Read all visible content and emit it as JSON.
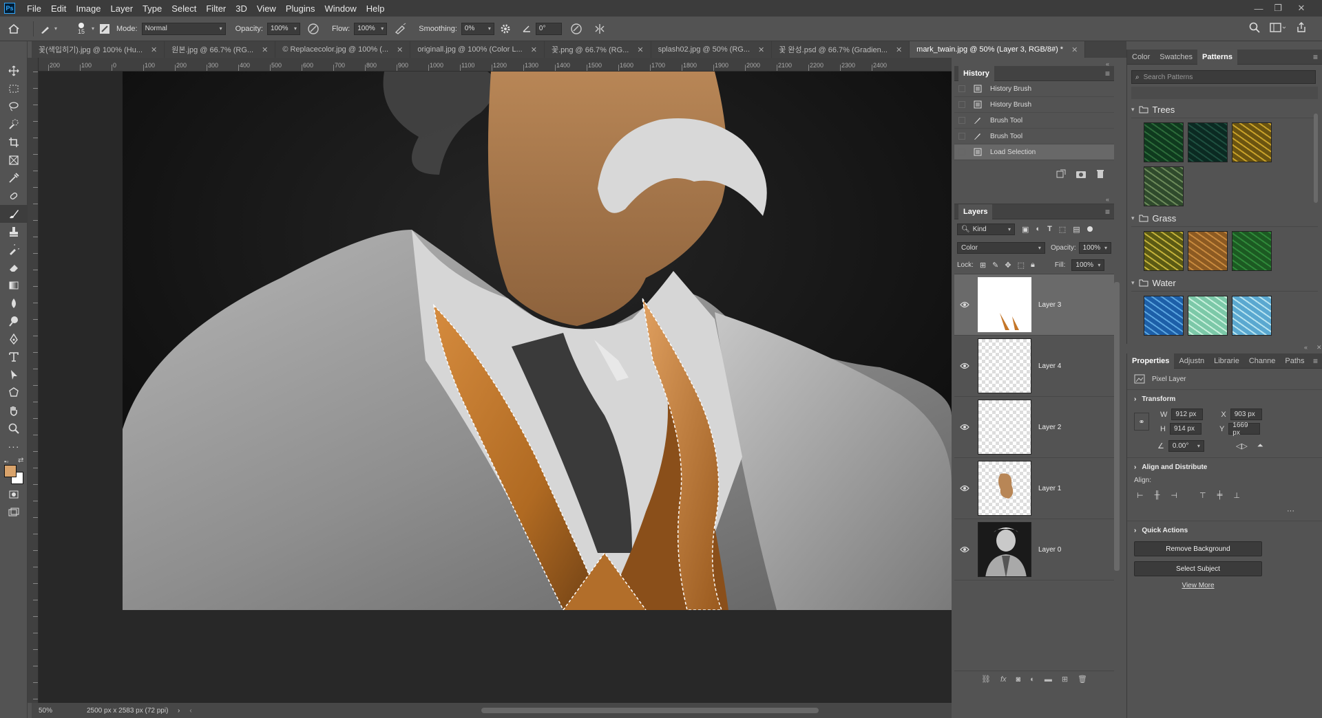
{
  "app": {
    "logo": "Ps",
    "menus": [
      "File",
      "Edit",
      "Image",
      "Layer",
      "Type",
      "Select",
      "Filter",
      "3D",
      "View",
      "Plugins",
      "Window",
      "Help"
    ]
  },
  "options": {
    "brush_size": "15",
    "mode_label": "Mode:",
    "mode_value": "Normal",
    "opacity_label": "Opacity:",
    "opacity_value": "100%",
    "flow_label": "Flow:",
    "flow_value": "100%",
    "smoothing_label": "Smoothing:",
    "smoothing_value": "0%",
    "angle_value": "0°"
  },
  "tabs": [
    {
      "label": "꽃(색입히기).jpg @ 100% (Hu..."
    },
    {
      "label": "원본.jpg @ 66.7% (RG..."
    },
    {
      "label": "© Replacecolor.jpg @ 100% (..."
    },
    {
      "label": "originall.jpg @ 100% (Color L..."
    },
    {
      "label": "꽃.png @ 66.7% (RG..."
    },
    {
      "label": "splash02.jpg @ 50% (RG..."
    },
    {
      "label": "꽃 완성.psd @ 66.7% (Gradien..."
    },
    {
      "label": "mark_twain.jpg @ 50% (Layer 3, RGB/8#) *"
    }
  ],
  "ruler": {
    "h_ticks": [
      "200",
      "100",
      "0",
      "100",
      "200",
      "300",
      "400",
      "500",
      "600",
      "700",
      "800",
      "900",
      "1000",
      "1100",
      "1200",
      "1300",
      "1400",
      "1500",
      "1600",
      "1700",
      "1800",
      "1900",
      "2000",
      "2100",
      "2200",
      "2300",
      "2400"
    ]
  },
  "status": {
    "zoom": "50%",
    "doc_info": "2500 px x 2583 px (72 ppi)"
  },
  "history": {
    "title": "History",
    "items": [
      {
        "label": "History Brush",
        "icon": "doc-icon"
      },
      {
        "label": "History Brush",
        "icon": "doc-icon"
      },
      {
        "label": "Brush Tool",
        "icon": "brush-icon"
      },
      {
        "label": "Brush Tool",
        "icon": "brush-icon"
      },
      {
        "label": "Load Selection",
        "icon": "doc-icon"
      }
    ]
  },
  "layers": {
    "title": "Layers",
    "filter_label": "Kind",
    "blend_mode": "Color",
    "opacity_label": "Opacity:",
    "opacity_value": "100%",
    "lock_label": "Lock:",
    "fill_label": "Fill:",
    "fill_value": "100%",
    "items": [
      {
        "name": "Layer 3"
      },
      {
        "name": "Layer 4"
      },
      {
        "name": "Layer 2"
      },
      {
        "name": "Layer 1"
      },
      {
        "name": "Layer 0"
      }
    ]
  },
  "patterns": {
    "tabs": [
      "Color",
      "Swatches",
      "Patterns"
    ],
    "search_placeholder": "Search Patterns",
    "groups": [
      {
        "name": "Trees",
        "swatches": [
          [
            "#0f3a1e",
            "#2c6b3a"
          ],
          [
            "#0b2a22",
            "#1f5040"
          ],
          [
            "#6b5410",
            "#c9a22a"
          ],
          [
            "#2f4a2c",
            "#6c8a5a"
          ]
        ]
      },
      {
        "name": "Grass",
        "swatches": [
          [
            "#5b5a14",
            "#c4b23a"
          ],
          [
            "#8c5a22",
            "#c98a3e"
          ],
          [
            "#1c5a22",
            "#2f8a3a"
          ]
        ]
      },
      {
        "name": "Water",
        "swatches": [
          [
            "#1d5fa8",
            "#5ba6e0"
          ],
          [
            "#7cc8a8",
            "#c8f0dc"
          ],
          [
            "#5aa8d0",
            "#b8e4f0"
          ]
        ]
      }
    ]
  },
  "properties": {
    "tabs": [
      "Properties",
      "Adjustn",
      "Librarie",
      "Channe",
      "Paths"
    ],
    "kind": "Pixel Layer",
    "transform": {
      "title": "Transform",
      "w_label": "W",
      "w": "912 px",
      "h_label": "H",
      "h": "914 px",
      "x_label": "X",
      "x": "903 px",
      "y_label": "Y",
      "y": "1669 px",
      "angle": "0.00°"
    },
    "align": {
      "title": "Align and Distribute",
      "label": "Align:"
    },
    "quick": {
      "title": "Quick Actions",
      "remove_bg": "Remove Background",
      "select_subject": "Select Subject",
      "view_more": "View More"
    }
  },
  "colors": {
    "foreground": "#d9a36b",
    "background": "#ffffff",
    "vest": "#c4772a",
    "skin": "#b88656",
    "accent": "#31a8ff"
  }
}
